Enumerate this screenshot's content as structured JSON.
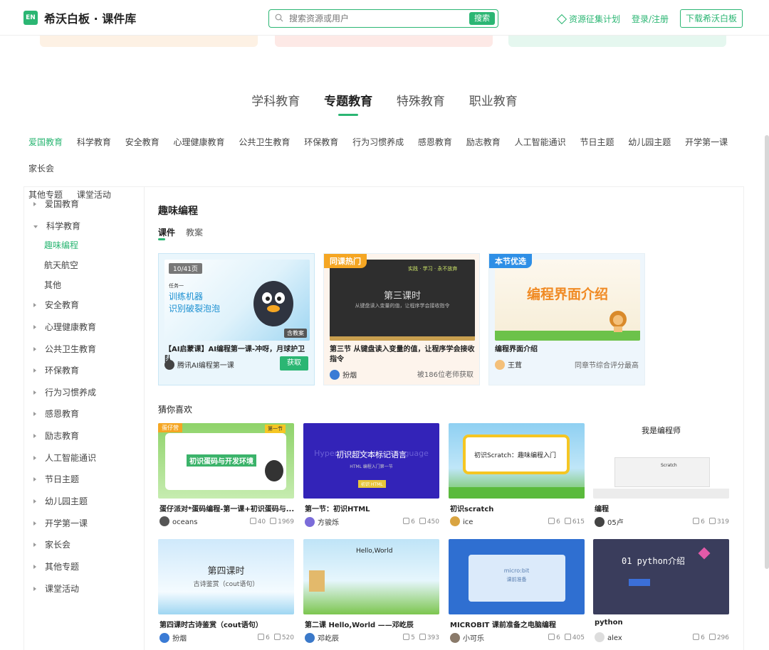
{
  "header": {
    "logo_badge": "EN",
    "logo_text": "希沃白板 · 课件库",
    "search_placeholder": "搜索资源或用户",
    "search_button": "搜索",
    "plan_link": "资源征集计划",
    "login_link": "登录/注册",
    "download_button": "下载希沃白板"
  },
  "main_tabs": [
    {
      "label": "学科教育"
    },
    {
      "label": "专题教育"
    },
    {
      "label": "特殊教育"
    },
    {
      "label": "职业教育"
    }
  ],
  "sub_categories": [
    "爱国教育",
    "科学教育",
    "安全教育",
    "心理健康教育",
    "公共卫生教育",
    "环保教育",
    "行为习惯养成",
    "感恩教育",
    "励志教育",
    "人工智能通识",
    "节日主题",
    "幼儿园主题",
    "开学第一课",
    "家长会",
    "其他专题",
    "课堂活动"
  ],
  "sidebar": {
    "items": [
      "爱国教育",
      "科学教育",
      "安全教育",
      "心理健康教育",
      "公共卫生教育",
      "环保教育",
      "行为习惯养成",
      "感恩教育",
      "励志教育",
      "人工智能通识",
      "节日主题",
      "幼儿园主题",
      "开学第一课",
      "家长会",
      "其他专题",
      "课堂活动"
    ],
    "sub_items": [
      "趣味编程",
      "航天航空",
      "其他"
    ]
  },
  "section": {
    "title": "趣味编程",
    "tabs": [
      "课件",
      "教案"
    ]
  },
  "featured": [
    {
      "page_badge": "10/41页",
      "thumb_line1": "任务一",
      "thumb_line2": "训练机器",
      "thumb_line3": "识别破裂泡泡",
      "thumb_badge": "含教案",
      "title": "【AI启蒙课】AI编程第一课-冲呀，月球护卫队",
      "user": "腾讯AI编程第一课",
      "action": "获取"
    },
    {
      "tag": "同课热门",
      "thumb_top": "实践 · 学习 · 永不放弃",
      "thumb_heading": "第三课时",
      "thumb_sub": "从键盘读入变量的值，让程序学会接收指令",
      "title": "第三节 从键盘读入变量的值，让程序学会接收指令",
      "user": "扮烟",
      "meta": "被186位老师获取"
    },
    {
      "tag": "本节优选",
      "thumb_heading": "编程界面介绍",
      "title": "编程界面介绍",
      "user": "王茸",
      "meta": "同章节综合评分最高"
    }
  ],
  "guess_title": "猜你喜欢",
  "grid": [
    {
      "title": "蛋仔派对*蛋码编程-第一课+初识蛋码与...",
      "user": "oceans",
      "likes": "40",
      "downloads": "1969",
      "thumb_tag": "蛋仔营",
      "thumb_text": "初识蛋码与开发环境",
      "thumb_badge": "第一节"
    },
    {
      "title": "第一节：初识HTML",
      "user": "方骏烁",
      "likes": "6",
      "downloads": "450",
      "thumb_text": "初识超文本标记语言",
      "thumb_bg_text": "Hyper Text Markup Language",
      "thumb_sub": "HTML 编程入门第一节",
      "thumb_chip": "初识 HTML"
    },
    {
      "title": "初识scratch",
      "user": "ice",
      "likes": "6",
      "downloads": "615",
      "thumb_text": "初识Scratch：趣味编程入门"
    },
    {
      "title": "编程",
      "user": "05卢",
      "likes": "6",
      "downloads": "319",
      "thumb_text": "我是编程师",
      "thumb_sub": "Scratch"
    },
    {
      "title": "第四课时古诗鉴赏（cout语句）",
      "user": "扮烟",
      "likes": "6",
      "downloads": "520",
      "thumb_text": "第四课时",
      "thumb_sub": "古诗鉴赏（cout语句）"
    },
    {
      "title": "第二课 Hello,World ——邓屹辰",
      "user": "邓屹辰",
      "likes": "5",
      "downloads": "393",
      "thumb_text": "Hello,World"
    },
    {
      "title": "MICROBIT 课前准备之电脑编程",
      "user": "小可乐",
      "likes": "6",
      "downloads": "405",
      "thumb_text": "micro:bit",
      "thumb_sub": "课前准备"
    },
    {
      "title": "python",
      "user": "alex",
      "likes": "6",
      "downloads": "296",
      "thumb_text": "01 python介绍"
    }
  ],
  "colors": {
    "accent": "#2bb673"
  }
}
